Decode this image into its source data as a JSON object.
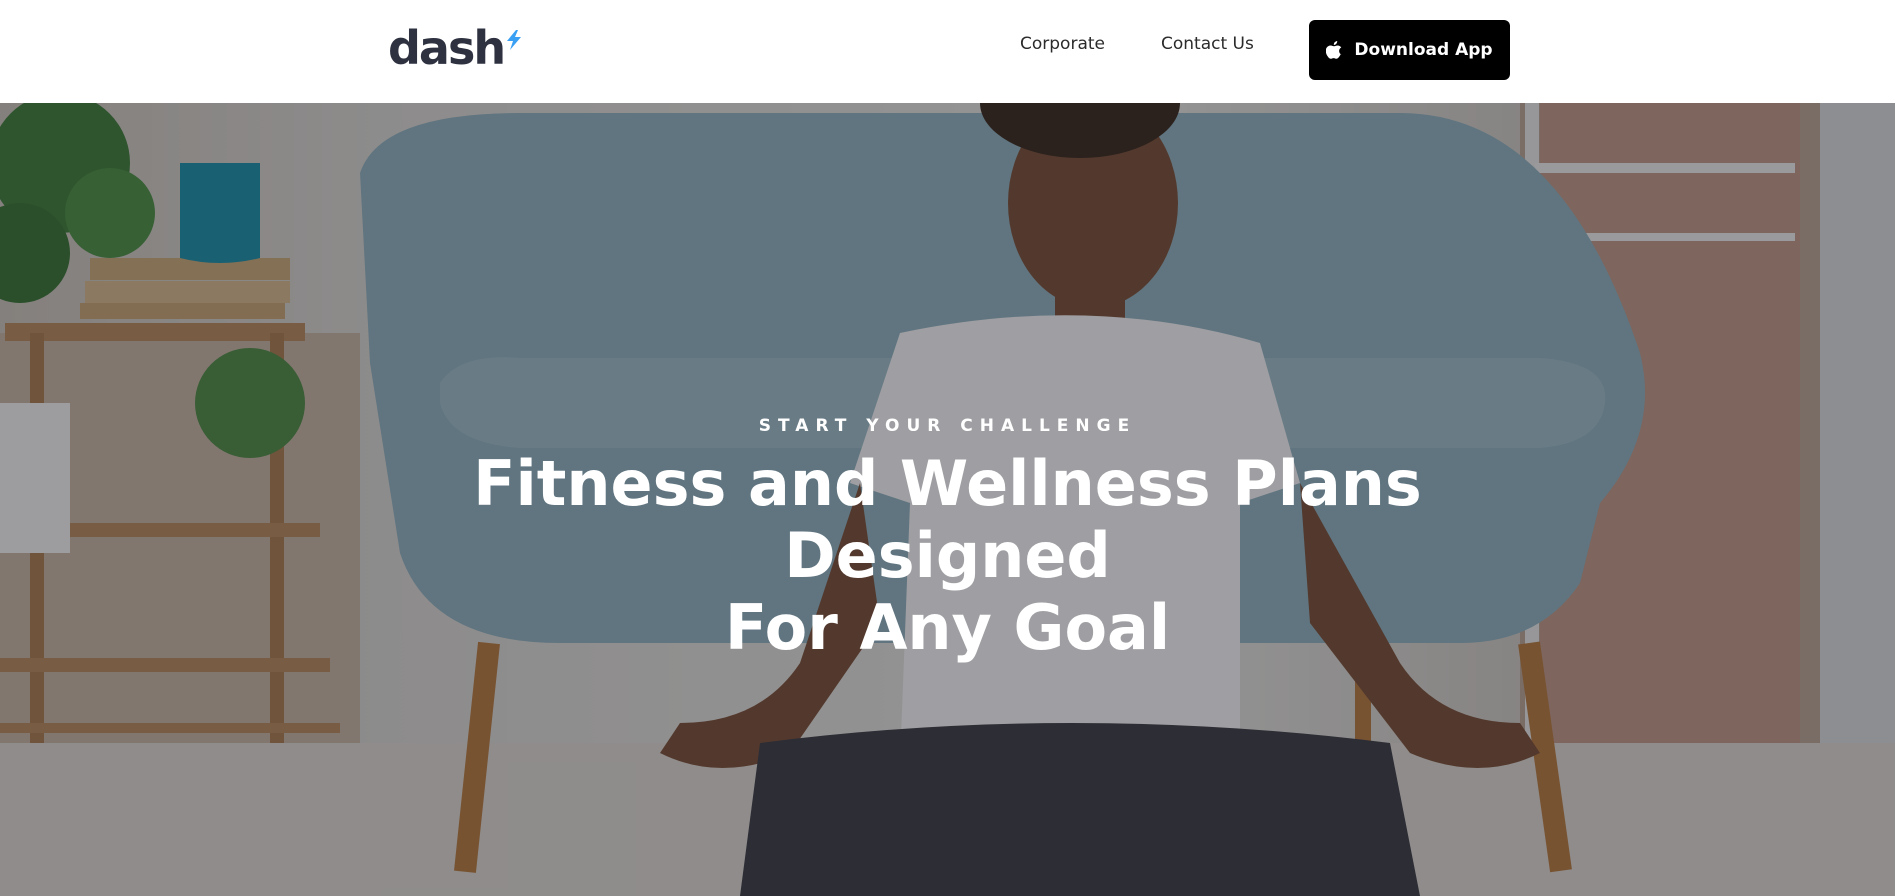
{
  "header": {
    "logo": {
      "text": "dash",
      "icon": "bolt-icon",
      "icon_color": "#3aa0f3"
    },
    "nav": {
      "corporate_label": "Corporate",
      "contact_label": "Contact Us"
    },
    "download_button": {
      "label": "Download App",
      "icon": "apple-icon"
    }
  },
  "hero": {
    "eyebrow": "START YOUR CHALLENGE",
    "title_line1": "Fitness and Wellness Plans Designed",
    "title_line2": "For Any Goal",
    "background": "photo: woman meditating cross-legged in front of a light blue sofa"
  },
  "colors": {
    "logo_text": "#2e3140",
    "button_bg": "#000000",
    "hero_text": "#ffffff"
  }
}
